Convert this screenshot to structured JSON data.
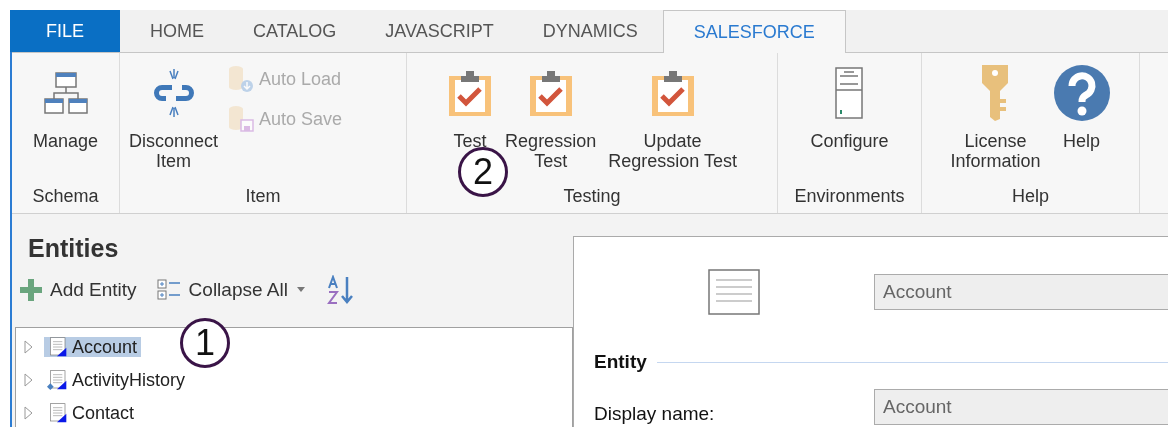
{
  "tabs": [
    {
      "label": "FILE",
      "kind": "file",
      "selected": false
    },
    {
      "label": "HOME",
      "kind": "tab",
      "selected": false
    },
    {
      "label": "CATALOG",
      "kind": "tab",
      "selected": false
    },
    {
      "label": "JAVASCRIPT",
      "kind": "tab",
      "selected": false
    },
    {
      "label": "DYNAMICS",
      "kind": "tab",
      "selected": false
    },
    {
      "label": "SALESFORCE",
      "kind": "tab",
      "selected": true
    }
  ],
  "ribbon": {
    "groups": [
      {
        "label": "Schema",
        "items": [
          {
            "kind": "large",
            "lines": [
              "Manage"
            ],
            "disabled": false
          }
        ]
      },
      {
        "label": "Item",
        "items": [
          {
            "kind": "large",
            "lines": [
              "Disconnect",
              "Item"
            ],
            "disabled": false
          },
          {
            "kind": "small",
            "lines": [
              "Auto Load"
            ],
            "disabled": true
          },
          {
            "kind": "small",
            "lines": [
              "Auto Save"
            ],
            "disabled": true
          }
        ]
      },
      {
        "label": "Testing",
        "items": [
          {
            "kind": "large",
            "lines": [
              "Test"
            ],
            "disabled": false
          },
          {
            "kind": "large",
            "lines": [
              "Regression",
              "Test"
            ],
            "disabled": false
          },
          {
            "kind": "large",
            "lines": [
              "Update",
              "Regression Test"
            ],
            "disabled": false
          }
        ]
      },
      {
        "label": "Environments",
        "items": [
          {
            "kind": "large",
            "lines": [
              "Configure"
            ],
            "disabled": false
          }
        ]
      },
      {
        "label": "Help",
        "items": [
          {
            "kind": "large",
            "lines": [
              "License",
              "Information"
            ],
            "disabled": false
          },
          {
            "kind": "large",
            "lines": [
              "Help"
            ],
            "disabled": false
          }
        ]
      }
    ]
  },
  "entities": {
    "title": "Entities",
    "toolbar": [
      {
        "kind": "add",
        "label": "Add Entity"
      },
      {
        "kind": "collapse",
        "label": "Collapse All"
      },
      {
        "kind": "sort"
      }
    ],
    "tree": [
      {
        "label": "Account",
        "selected": true,
        "expanded": false,
        "kind": "entity"
      },
      {
        "label": "ActivityHistory",
        "selected": false,
        "expanded": false,
        "kind": "history"
      },
      {
        "label": "Contact",
        "selected": false,
        "expanded": false,
        "kind": "entity"
      }
    ]
  },
  "details": {
    "name_value": "Account",
    "section": "Entity",
    "fields": [
      {
        "label": "Display name:",
        "value": "Account"
      }
    ]
  },
  "callouts": [
    {
      "label": "1"
    },
    {
      "label": "2"
    }
  ]
}
